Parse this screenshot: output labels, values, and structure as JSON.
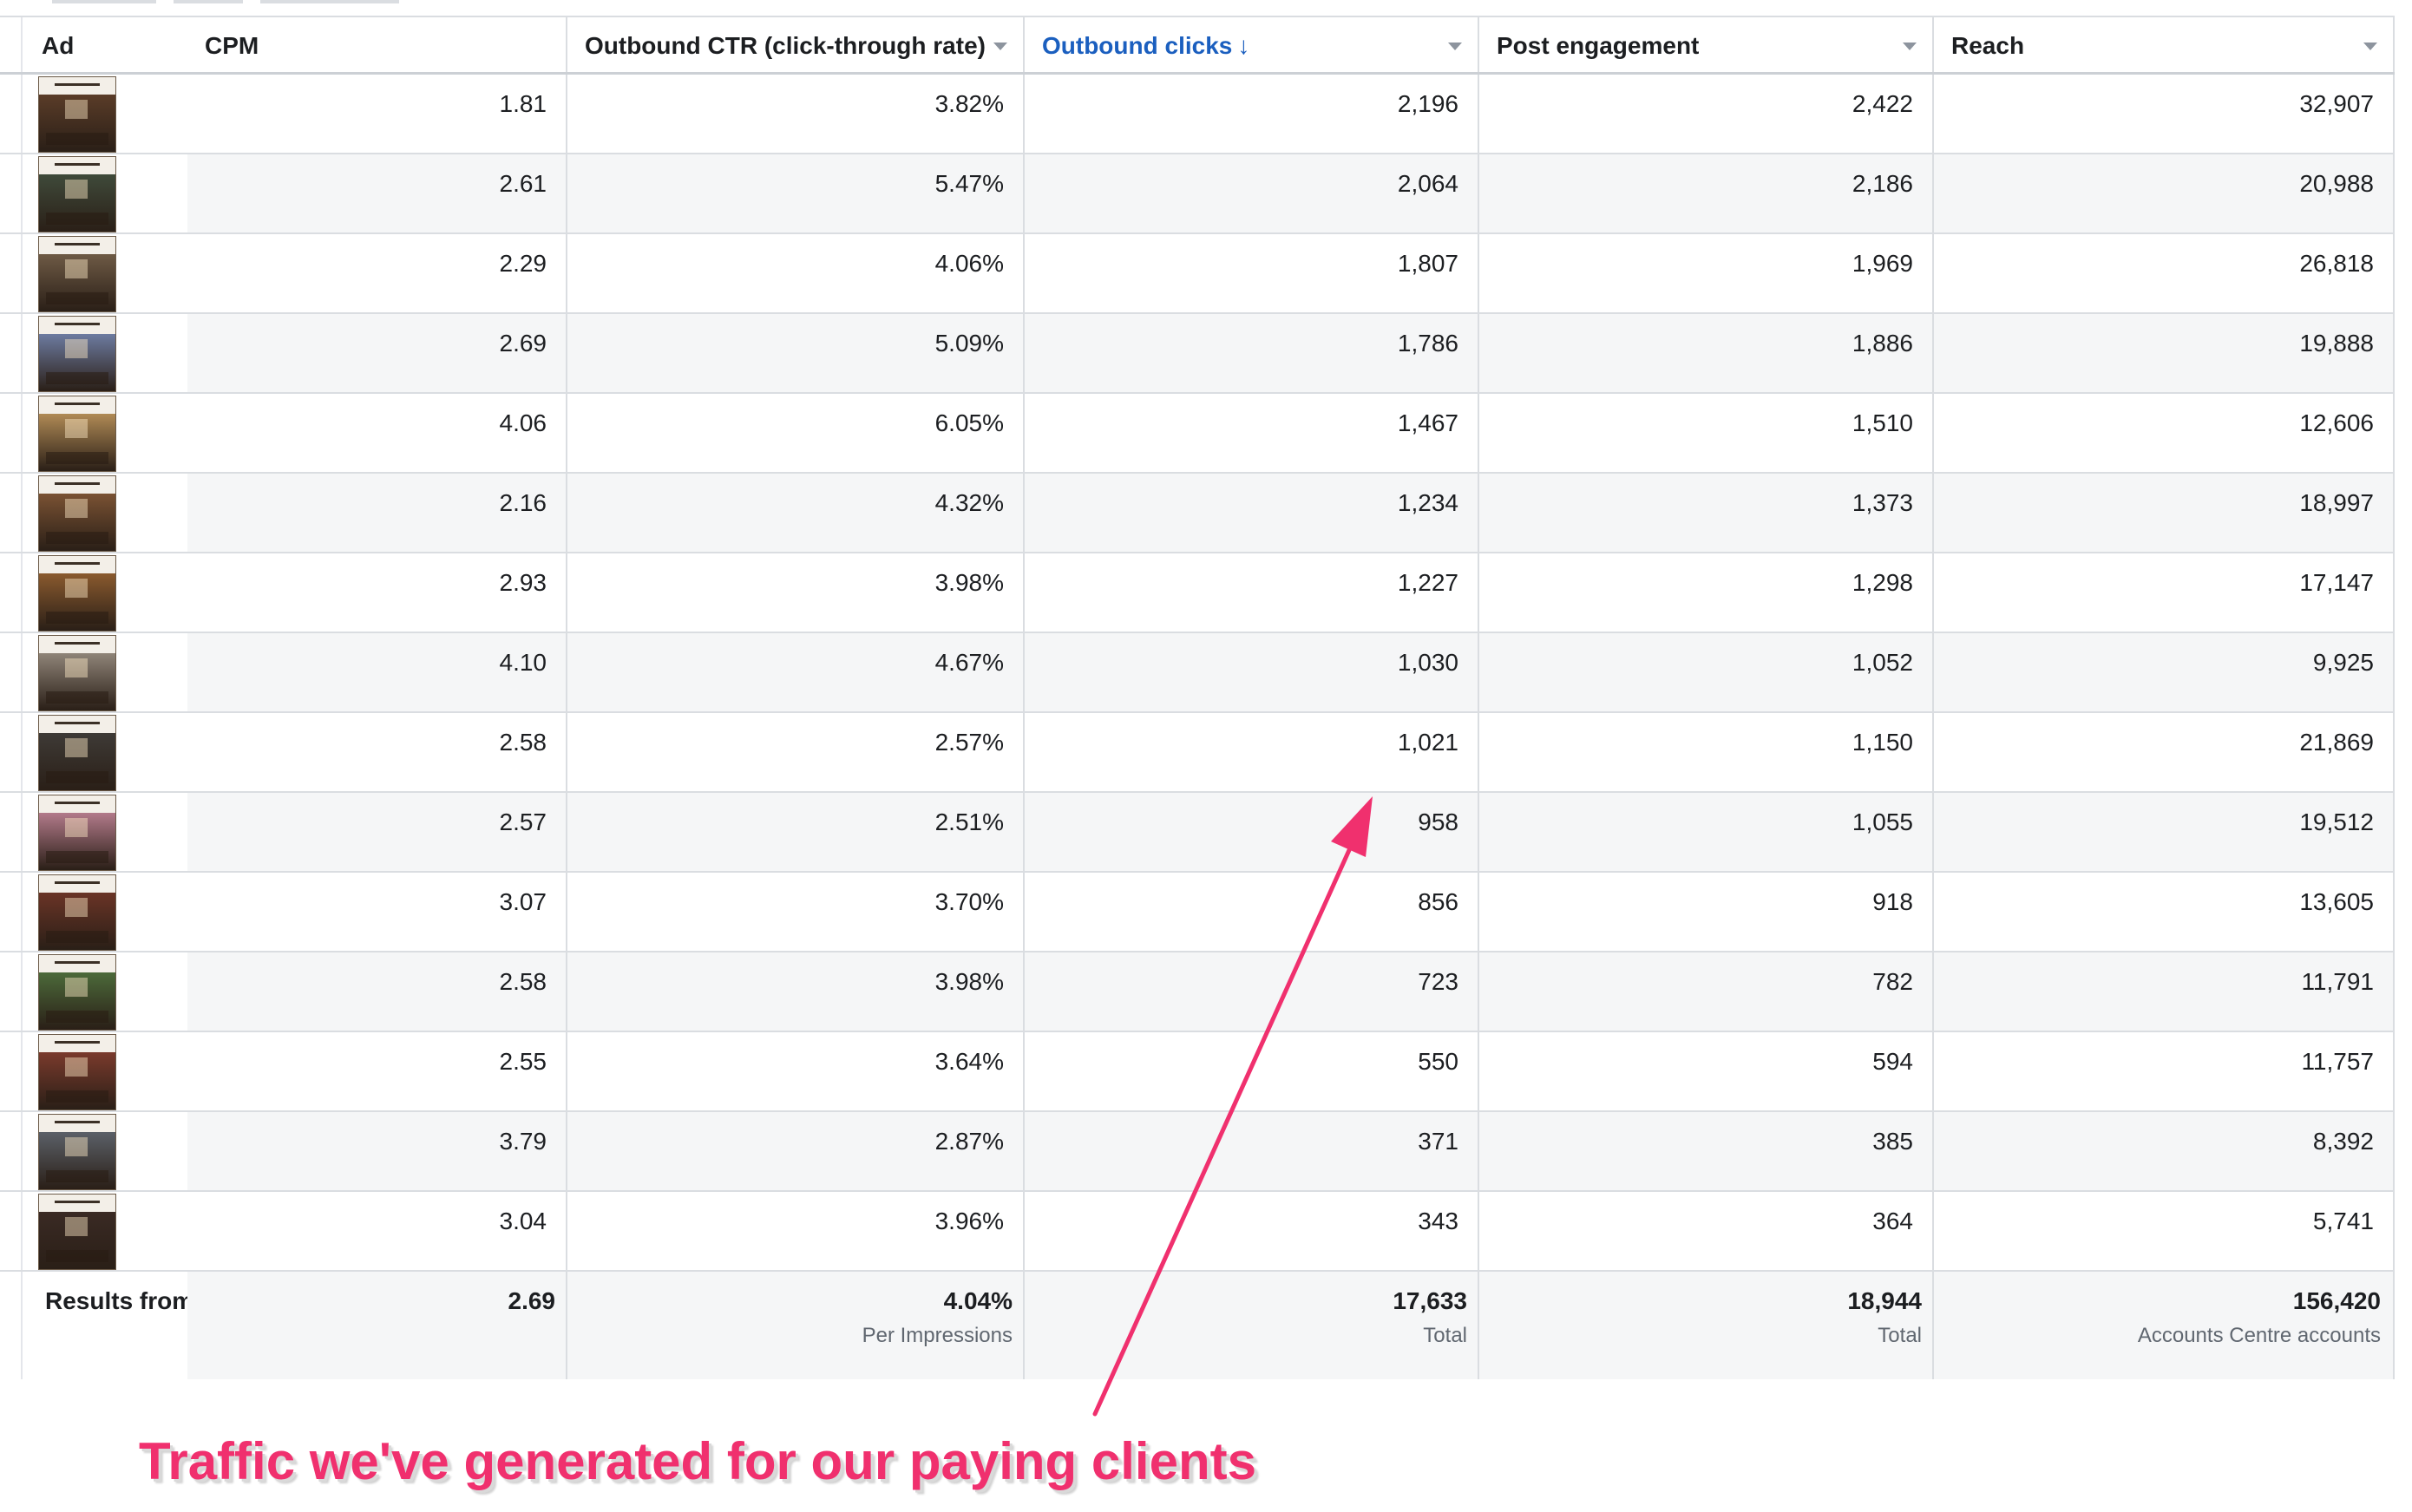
{
  "columns": {
    "ad": "Ad",
    "cpm": "CPM",
    "ctr": "Outbound CTR (click-through rate)",
    "clicks": "Outbound clicks",
    "clicks_sort_glyph": "↓",
    "engagement": "Post engagement",
    "reach": "Reach"
  },
  "rows": [
    {
      "cpm": "1.81",
      "ctr": "3.82%",
      "clicks": "2,196",
      "engagement": "2,422",
      "reach": "32,907",
      "thumb_color": "#5a3c28"
    },
    {
      "cpm": "2.61",
      "ctr": "5.47%",
      "clicks": "2,064",
      "engagement": "2,186",
      "reach": "20,988",
      "thumb_color": "#3f4a3a"
    },
    {
      "cpm": "2.29",
      "ctr": "4.06%",
      "clicks": "1,807",
      "engagement": "1,969",
      "reach": "26,818",
      "thumb_color": "#6e5a45"
    },
    {
      "cpm": "2.69",
      "ctr": "5.09%",
      "clicks": "1,786",
      "engagement": "1,886",
      "reach": "19,888",
      "thumb_color": "#6d7ba0"
    },
    {
      "cpm": "4.06",
      "ctr": "6.05%",
      "clicks": "1,467",
      "engagement": "1,510",
      "reach": "12,606",
      "thumb_color": "#b08a55"
    },
    {
      "cpm": "2.16",
      "ctr": "4.32%",
      "clicks": "1,234",
      "engagement": "1,373",
      "reach": "18,997",
      "thumb_color": "#7a5233"
    },
    {
      "cpm": "2.93",
      "ctr": "3.98%",
      "clicks": "1,227",
      "engagement": "1,298",
      "reach": "17,147",
      "thumb_color": "#8a5a2e"
    },
    {
      "cpm": "4.10",
      "ctr": "4.67%",
      "clicks": "1,030",
      "engagement": "1,052",
      "reach": "9,925",
      "thumb_color": "#8f8478"
    },
    {
      "cpm": "2.58",
      "ctr": "2.57%",
      "clicks": "1,021",
      "engagement": "1,150",
      "reach": "21,869",
      "thumb_color": "#3e3a36"
    },
    {
      "cpm": "2.57",
      "ctr": "2.51%",
      "clicks": "958",
      "engagement": "1,055",
      "reach": "19,512",
      "thumb_color": "#b27a8a"
    },
    {
      "cpm": "3.07",
      "ctr": "3.70%",
      "clicks": "856",
      "engagement": "918",
      "reach": "13,605",
      "thumb_color": "#6a3426"
    },
    {
      "cpm": "2.58",
      "ctr": "3.98%",
      "clicks": "723",
      "engagement": "782",
      "reach": "11,791",
      "thumb_color": "#4c6a3a"
    },
    {
      "cpm": "2.55",
      "ctr": "3.64%",
      "clicks": "550",
      "engagement": "594",
      "reach": "11,757",
      "thumb_color": "#7a3a2c"
    },
    {
      "cpm": "3.79",
      "ctr": "2.87%",
      "clicks": "371",
      "engagement": "385",
      "reach": "8,392",
      "thumb_color": "#5b6068"
    },
    {
      "cpm": "3.04",
      "ctr": "3.96%",
      "clicks": "343",
      "engagement": "364",
      "reach": "5,741",
      "thumb_color": "#3a2a24"
    }
  ],
  "totals": {
    "label": "Results from",
    "cpm": "2.69",
    "ctr": "4.04%",
    "ctr_sub": "Per Impressions",
    "clicks": "17,633",
    "clicks_sub": "Total",
    "engagement": "18,944",
    "engagement_sub": "Total",
    "reach": "156,420",
    "reach_sub": "Accounts Centre accounts"
  },
  "annotation": {
    "text": "Traffic we've generated for our paying clients",
    "color": "#f0306e"
  },
  "colors": {
    "sorted_header": "#1b5fbf",
    "row_shade": "#f5f6f7",
    "grid_line": "#dadde1"
  }
}
